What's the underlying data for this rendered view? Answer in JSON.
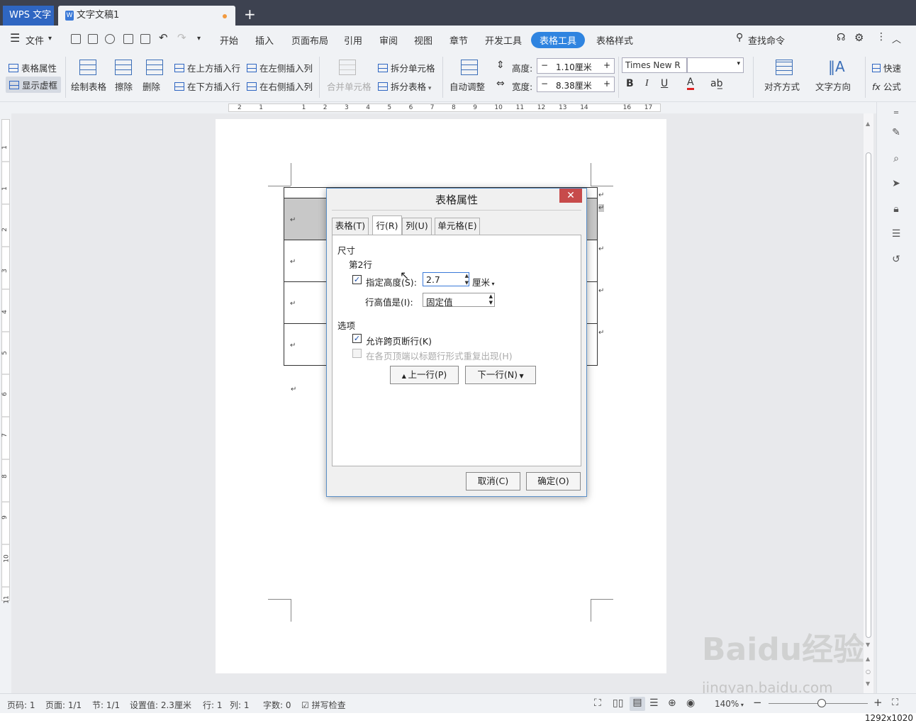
{
  "tabs": {
    "app": "WPS 文字",
    "doc": "文字文稿1",
    "add": "+"
  },
  "menu": {
    "file": "文件",
    "items": [
      "开始",
      "插入",
      "页面布局",
      "引用",
      "审阅",
      "视图",
      "章节",
      "开发工具",
      "表格工具",
      "表格样式"
    ],
    "search": "查找命令"
  },
  "ribbon": {
    "table_props": "表格属性",
    "show_grid": "显示虚框",
    "draw_table": "绘制表格",
    "erase": "擦除",
    "delete": "删除",
    "ins_above": "在上方插入行",
    "ins_below": "在下方插入行",
    "ins_left": "在左侧插入列",
    "ins_right": "在右侧插入列",
    "merge": "合并单元格",
    "split_cell": "拆分单元格",
    "split_table": "拆分表格",
    "auto_fit": "自动调整",
    "height_label": "高度:",
    "height_val": "1.10厘米",
    "width_label": "宽度:",
    "width_val": "8.38厘米",
    "font": "Times New R",
    "bold": "B",
    "italic": "I",
    "underline": "U",
    "font_color": "A",
    "align": "对齐方式",
    "text_dir": "文字方向",
    "quick": "快速",
    "formula": "公式"
  },
  "ruler": {
    "h": [
      "2",
      "1",
      "",
      "1",
      "2",
      "3",
      "4",
      "5",
      "6",
      "7",
      "8",
      "9",
      "10",
      "11",
      "12",
      "13",
      "14",
      "",
      "16",
      "17"
    ],
    "v": [
      "1",
      "1",
      "2",
      "3",
      "4",
      "5",
      "6",
      "7",
      "8",
      "9",
      "10",
      "11"
    ]
  },
  "dialog": {
    "title": "表格属性",
    "close": "✕",
    "tabs": [
      "表格(T)",
      "行(R)",
      "列(U)",
      "单元格(E)"
    ],
    "section_size": "尺寸",
    "row_label": "第2行",
    "spec_height": "指定高度(S):",
    "height_value": "2.7",
    "unit": "厘米",
    "row_height_is": "行高值是(I):",
    "row_height_mode": "固定值",
    "section_options": "选项",
    "allow_break": "允许跨页断行(K)",
    "repeat_header": "在各页顶端以标题行形式重复出现(H)",
    "prev_row": "上一行(P)",
    "next_row": "下一行(N)",
    "cancel": "取消(C)",
    "ok": "确定(O)"
  },
  "status": {
    "page": "页码: 1",
    "pages": "页面: 1/1",
    "section": "节: 1/1",
    "setting": "设置值: 2.3厘米",
    "row": "行: 1",
    "col": "列: 1",
    "words": "字数: 0",
    "spell": "拼写检查",
    "zoom": "140%"
  },
  "watermark": {
    "brand": "Baidu经验",
    "url": "jingyan.baidu.com"
  },
  "resolution": "1292x1020"
}
